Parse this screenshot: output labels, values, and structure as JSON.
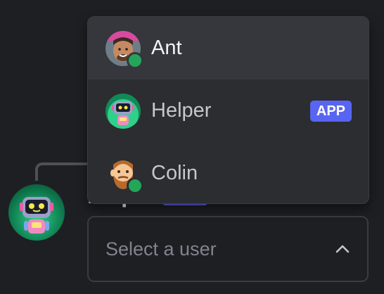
{
  "dropdown": {
    "options": [
      {
        "label": "Ant",
        "status": "online",
        "active": true
      },
      {
        "label": "Helper",
        "badge": "APP",
        "active": false
      },
      {
        "label": "Colin",
        "status": "online",
        "active": false
      }
    ]
  },
  "select": {
    "placeholder": "Select a user"
  },
  "colors": {
    "background": "#1e1f23",
    "menu": "#2b2d31",
    "highlight": "#35373c",
    "online": "#23a55a",
    "badge": "#5865f2"
  }
}
